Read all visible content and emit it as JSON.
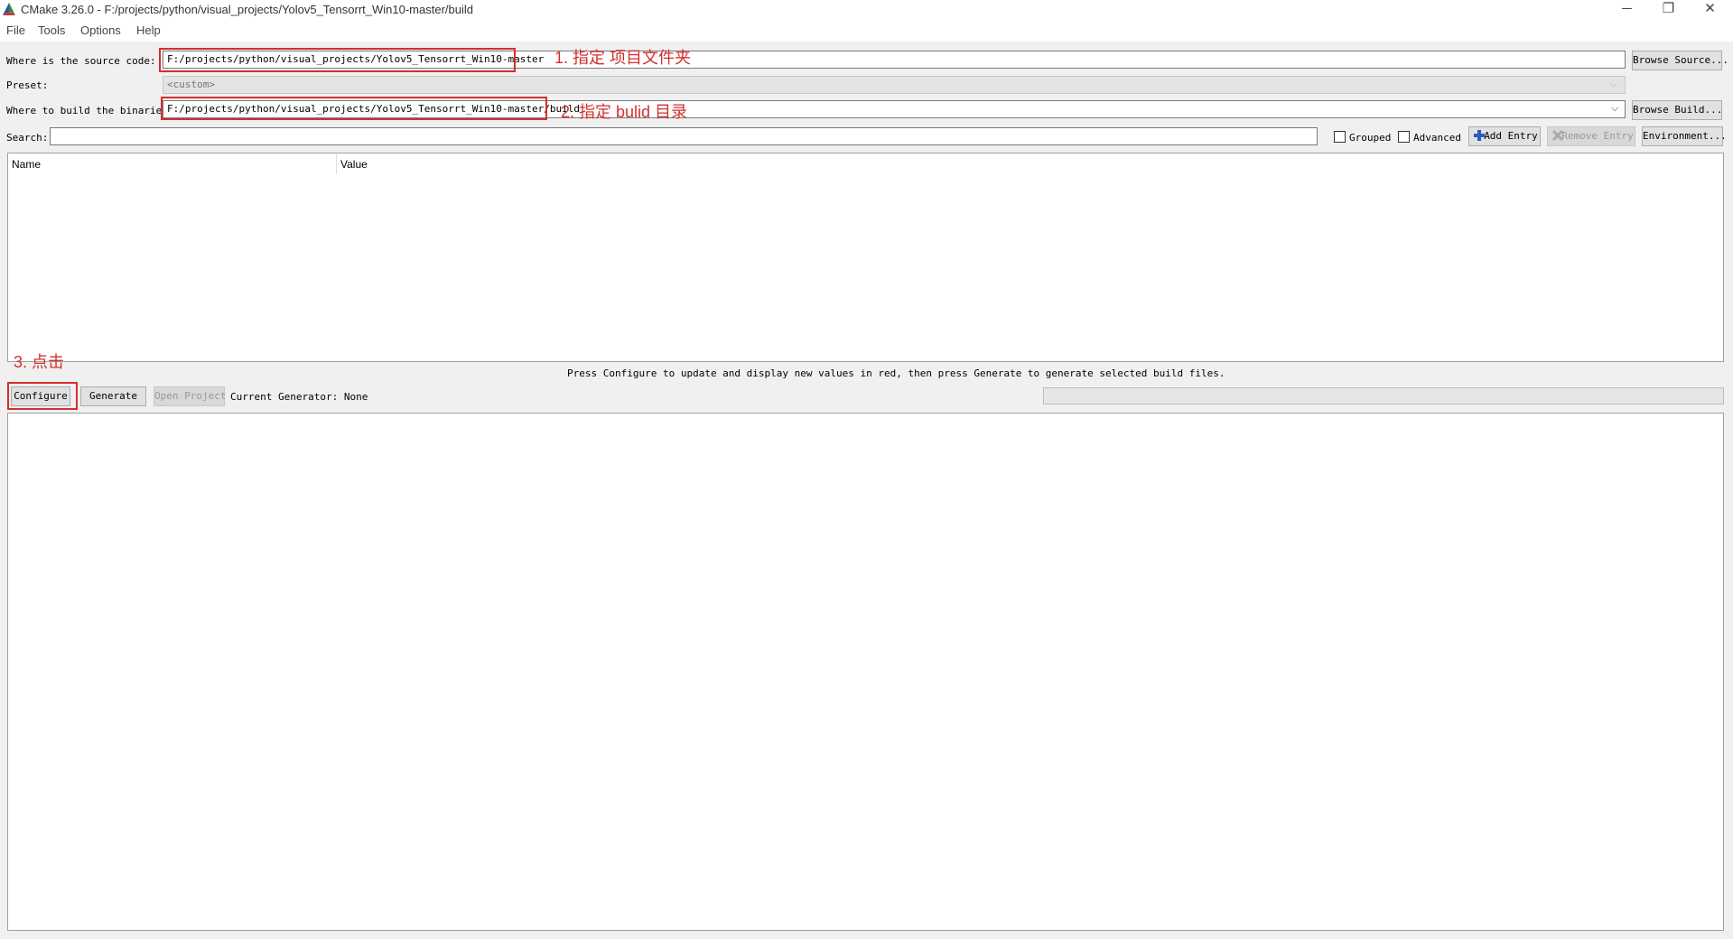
{
  "window": {
    "title": "CMake 3.26.0 - F:/projects/python/visual_projects/Yolov5_Tensorrt_Win10-master/build",
    "minimize": "─",
    "restore": "❐",
    "close": "✕"
  },
  "menu": [
    "File",
    "Tools",
    "Options",
    "Help"
  ],
  "source": {
    "label": "Where is the source code:",
    "value": "F:/projects/python/visual_projects/Yolov5_Tensorrt_Win10-master",
    "browse": "Browse Source..."
  },
  "preset": {
    "label": "Preset:",
    "value": "<custom>"
  },
  "build": {
    "label": "Where to build the binaries:",
    "value": "F:/projects/python/visual_projects/Yolov5_Tensorrt_Win10-master/build",
    "browse": "Browse Build..."
  },
  "search": {
    "label": "Search:",
    "value": "",
    "grouped": "Grouped",
    "advanced": "Advanced",
    "add_entry": "Add Entry",
    "remove_entry": "Remove Entry",
    "environment": "Environment..."
  },
  "table": {
    "col_name": "Name",
    "col_value": "Value"
  },
  "hint": "Press Configure to update and display new values in red,  then press Generate to generate selected build files.",
  "actions": {
    "configure": "Configure",
    "generate": "Generate",
    "open_project": "Open Project",
    "generator": "Current Generator: None"
  },
  "annotations": {
    "a1": "1. 指定 项目文件夹",
    "a2": "2. 指定 bulid 目录",
    "a3": "3. 点击"
  },
  "colors": {
    "annotation": "#d32f2f"
  }
}
